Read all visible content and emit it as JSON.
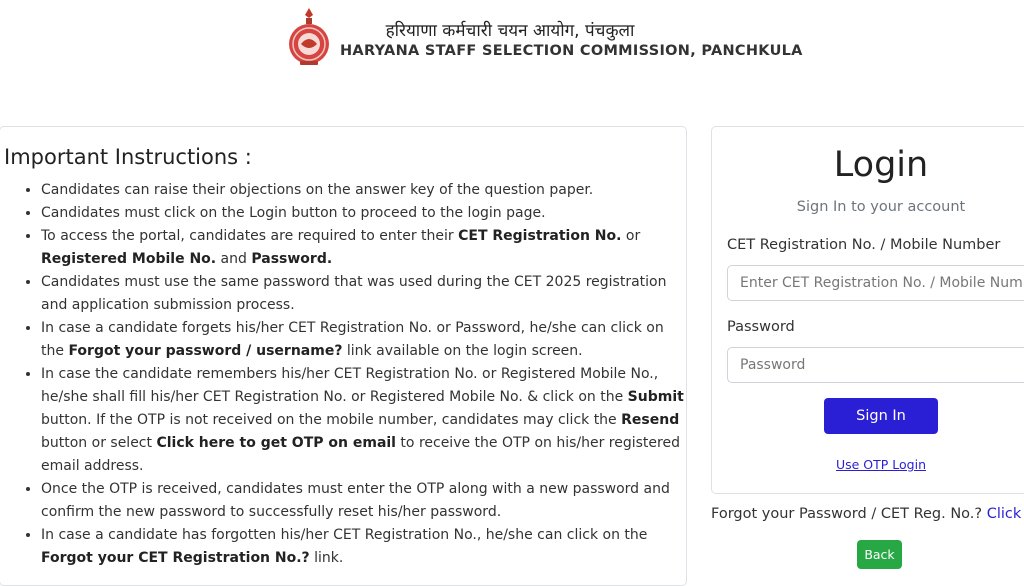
{
  "header": {
    "title_hindi": "हरियाणा कर्मचारी चयन आयोग, पंचकुला",
    "title_english": "HARYANA STAFF SELECTION COMMISSION, PANCHKULA",
    "emblem_icon": "state-emblem-icon"
  },
  "instructions": {
    "heading": "Important Instructions :",
    "items": [
      [
        {
          "t": "Candidates can raise their objections on the answer key of the question paper."
        }
      ],
      [
        {
          "t": "Candidates must click on the Login button to proceed to the login page."
        }
      ],
      [
        {
          "t": "To access the portal, candidates are required to enter their "
        },
        {
          "t": "CET Registration No.",
          "b": true
        },
        {
          "t": " or "
        },
        {
          "t": "Registered Mobile No.",
          "b": true
        },
        {
          "t": " and "
        },
        {
          "t": "Password.",
          "b": true
        }
      ],
      [
        {
          "t": "Candidates must use the same password that was used during the CET 2025 registration and application submission process."
        }
      ],
      [
        {
          "t": "In case a candidate forgets his/her CET Registration No. or Password, he/she can click on the "
        },
        {
          "t": "Forgot your password / username?",
          "b": true
        },
        {
          "t": " link available on the login screen."
        }
      ],
      [
        {
          "t": "In case the candidate remembers his/her CET Registration No. or Registered Mobile No., he/she shall fill his/her CET Registration No. or Registered Mobile No. & click on the "
        },
        {
          "t": "Submit",
          "b": true
        },
        {
          "t": " button. If the OTP is not received on the mobile number, candidates may click the "
        },
        {
          "t": "Resend",
          "b": true
        },
        {
          "t": " button or select "
        },
        {
          "t": "Click here to get OTP on email",
          "b": true
        },
        {
          "t": " to receive the OTP on his/her registered email address."
        }
      ],
      [
        {
          "t": "Once the OTP is received, candidates must enter the OTP along with a new password and confirm the new password to successfully reset his/her password."
        }
      ],
      [
        {
          "t": "In case a candidate has forgotten his/her CET Registration No., he/she can click on the "
        },
        {
          "t": "Forgot your CET Registration No.?",
          "b": true
        },
        {
          "t": " link."
        }
      ]
    ]
  },
  "login": {
    "title": "Login",
    "subtitle": "Sign In to your account",
    "reg_label": "CET Registration No. / Mobile Number",
    "reg_placeholder": "Enter CET Registration No. / Mobile Number",
    "password_label": "Password",
    "password_placeholder": "Password",
    "signin_label": "Sign In",
    "otp_link": "Use OTP Login"
  },
  "footer": {
    "forgot_text": "Forgot your Password / CET Reg. No.?",
    "forgot_link": "Click here",
    "back_label": "Back"
  },
  "colors": {
    "primary": "#2b1fd6",
    "success": "#28a745"
  }
}
